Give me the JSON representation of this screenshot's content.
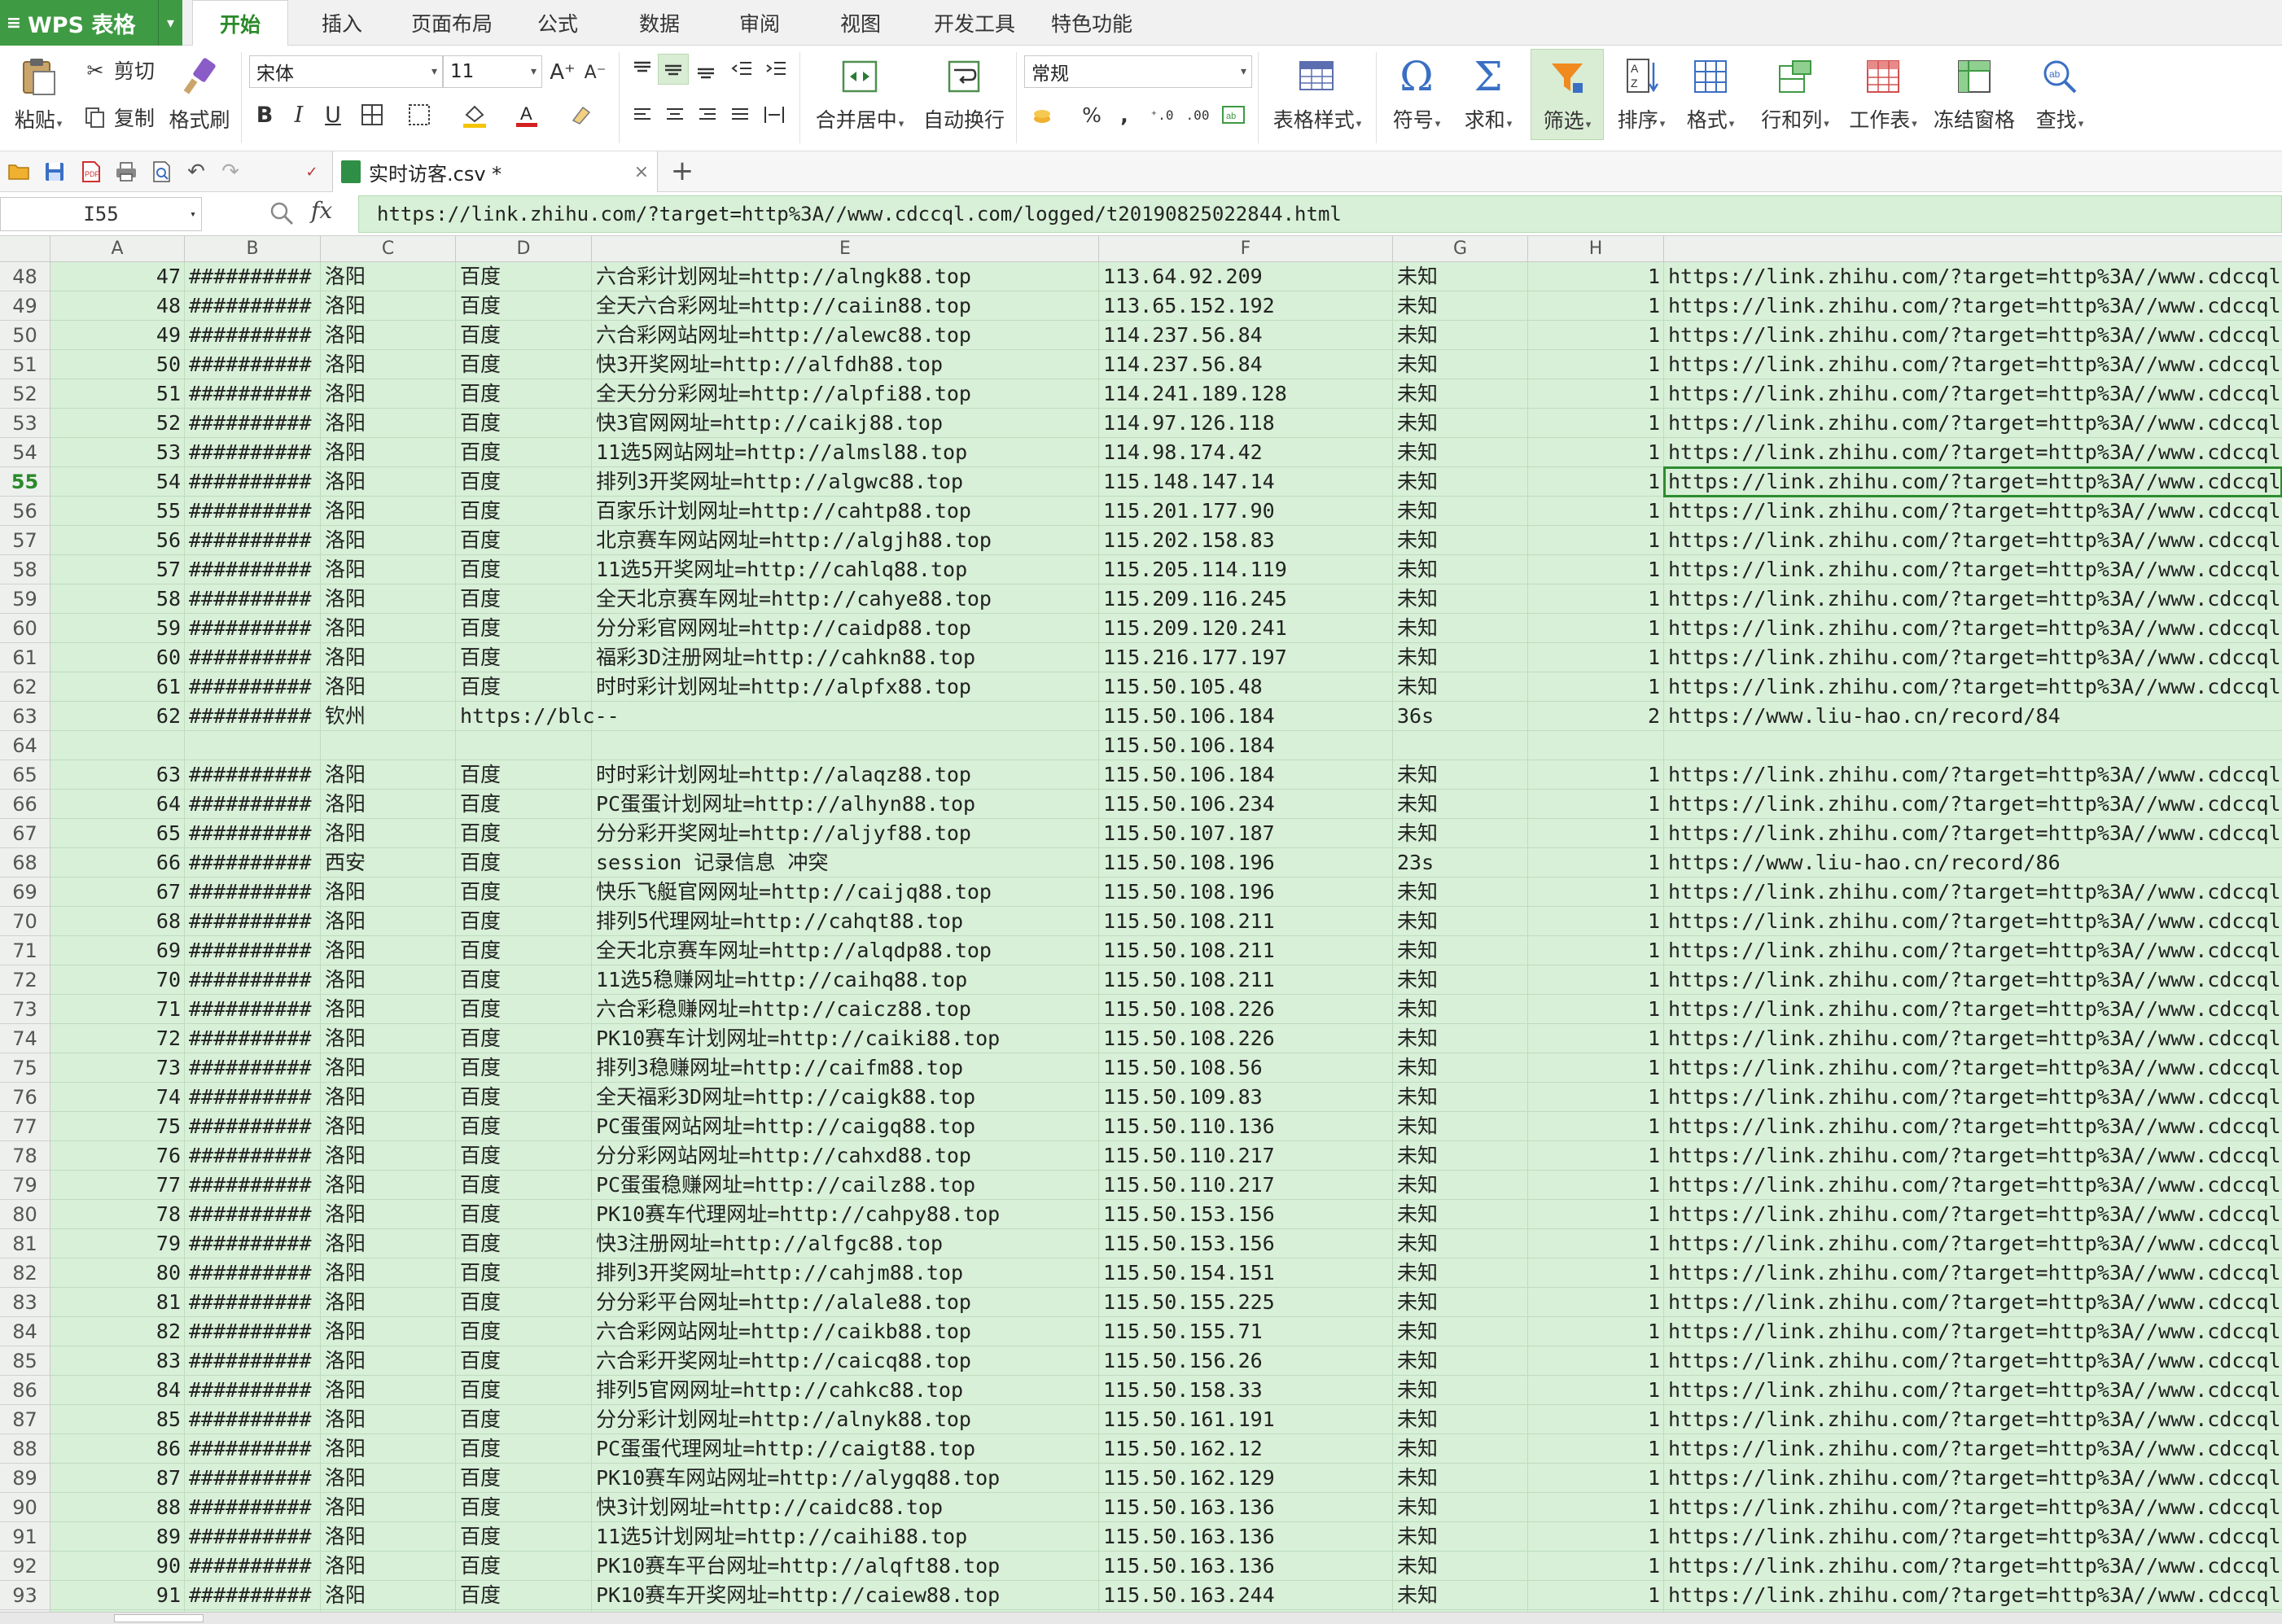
{
  "app": {
    "name": "WPS 表格"
  },
  "ribbon_tabs": [
    "开始",
    "插入",
    "页面布局",
    "公式",
    "数据",
    "审阅",
    "视图",
    "开发工具",
    "特色功能"
  ],
  "ribbon": {
    "paste": "粘贴",
    "cut": "剪切",
    "copy": "复制",
    "format_painter": "格式刷",
    "font_name": "宋体",
    "font_size": "11",
    "merge_center": "合并居中",
    "wrap_text": "自动换行",
    "number_format": "常规",
    "table_style": "表格样式",
    "symbol": "符号",
    "sum": "求和",
    "filter": "筛选",
    "sort": "排序",
    "format": "格式",
    "rows_cols": "行和列",
    "worksheet": "工作表",
    "freeze": "冻结窗格",
    "find": "查找",
    "percent": "%",
    "comma": ","
  },
  "document_tab": {
    "name": "实时访客.csv *"
  },
  "formula_bar": {
    "cell_ref": "I55",
    "fx": "fx",
    "value": "https://link.zhihu.com/?target=http%3A//www.cdccql.com/logged/t20190825022844.html"
  },
  "columns": [
    "A",
    "B",
    "C",
    "D",
    "E",
    "F",
    "G",
    "H"
  ],
  "rows": [
    {
      "n": "48",
      "a": "47",
      "b": "##########",
      "c": "洛阳",
      "d": "百度",
      "e": "六合彩计划网址=http://alngk88.top",
      "f": "113.64.92.209",
      "g": "未知",
      "h": "1",
      "i": "https://link.zhihu.com/?target=http%3A//www.cdccql"
    },
    {
      "n": "49",
      "a": "48",
      "b": "##########",
      "c": "洛阳",
      "d": "百度",
      "e": "全天六合彩网址=http://caiin88.top",
      "f": "113.65.152.192",
      "g": "未知",
      "h": "1",
      "i": "https://link.zhihu.com/?target=http%3A//www.cdccql"
    },
    {
      "n": "50",
      "a": "49",
      "b": "##########",
      "c": "洛阳",
      "d": "百度",
      "e": "六合彩网站网址=http://alewc88.top",
      "f": "114.237.56.84",
      "g": "未知",
      "h": "1",
      "i": "https://link.zhihu.com/?target=http%3A//www.cdccql"
    },
    {
      "n": "51",
      "a": "50",
      "b": "##########",
      "c": "洛阳",
      "d": "百度",
      "e": "快3开奖网址=http://alfdh88.top",
      "f": "114.237.56.84",
      "g": "未知",
      "h": "1",
      "i": "https://link.zhihu.com/?target=http%3A//www.cdccql"
    },
    {
      "n": "52",
      "a": "51",
      "b": "##########",
      "c": "洛阳",
      "d": "百度",
      "e": "全天分分彩网址=http://alpfi88.top",
      "f": "114.241.189.128",
      "g": "未知",
      "h": "1",
      "i": "https://link.zhihu.com/?target=http%3A//www.cdccql"
    },
    {
      "n": "53",
      "a": "52",
      "b": "##########",
      "c": "洛阳",
      "d": "百度",
      "e": "快3官网网址=http://caikj88.top",
      "f": "114.97.126.118",
      "g": "未知",
      "h": "1",
      "i": "https://link.zhihu.com/?target=http%3A//www.cdccql"
    },
    {
      "n": "54",
      "a": "53",
      "b": "##########",
      "c": "洛阳",
      "d": "百度",
      "e": "11选5网站网址=http://almsl88.top",
      "f": "114.98.174.42",
      "g": "未知",
      "h": "1",
      "i": "https://link.zhihu.com/?target=http%3A//www.cdccql"
    },
    {
      "n": "55",
      "a": "54",
      "b": "##########",
      "c": "洛阳",
      "d": "百度",
      "e": "排列3开奖网址=http://algwc88.top",
      "f": "115.148.147.14",
      "g": "未知",
      "h": "1",
      "i": "https://link.zhihu.com/?target=http%3A//www.cdccql"
    },
    {
      "n": "56",
      "a": "55",
      "b": "##########",
      "c": "洛阳",
      "d": "百度",
      "e": "百家乐计划网址=http://cahtp88.top",
      "f": "115.201.177.90",
      "g": "未知",
      "h": "1",
      "i": "https://link.zhihu.com/?target=http%3A//www.cdccql"
    },
    {
      "n": "57",
      "a": "56",
      "b": "##########",
      "c": "洛阳",
      "d": "百度",
      "e": "北京赛车网站网址=http://algjh88.top",
      "f": "115.202.158.83",
      "g": "未知",
      "h": "1",
      "i": "https://link.zhihu.com/?target=http%3A//www.cdccql"
    },
    {
      "n": "58",
      "a": "57",
      "b": "##########",
      "c": "洛阳",
      "d": "百度",
      "e": "11选5开奖网址=http://cahlq88.top",
      "f": "115.205.114.119",
      "g": "未知",
      "h": "1",
      "i": "https://link.zhihu.com/?target=http%3A//www.cdccql"
    },
    {
      "n": "59",
      "a": "58",
      "b": "##########",
      "c": "洛阳",
      "d": "百度",
      "e": "全天北京赛车网址=http://cahye88.top",
      "f": "115.209.116.245",
      "g": "未知",
      "h": "1",
      "i": "https://link.zhihu.com/?target=http%3A//www.cdccql"
    },
    {
      "n": "60",
      "a": "59",
      "b": "##########",
      "c": "洛阳",
      "d": "百度",
      "e": "分分彩官网网址=http://caidp88.top",
      "f": "115.209.120.241",
      "g": "未知",
      "h": "1",
      "i": "https://link.zhihu.com/?target=http%3A//www.cdccql"
    },
    {
      "n": "61",
      "a": "60",
      "b": "##########",
      "c": "洛阳",
      "d": "百度",
      "e": "福彩3D注册网址=http://cahkn88.top",
      "f": "115.216.177.197",
      "g": "未知",
      "h": "1",
      "i": "https://link.zhihu.com/?target=http%3A//www.cdccql"
    },
    {
      "n": "62",
      "a": "61",
      "b": "##########",
      "c": "洛阳",
      "d": "百度",
      "e": "时时彩计划网址=http://alpfx88.top",
      "f": "115.50.105.48",
      "g": "未知",
      "h": "1",
      "i": "https://link.zhihu.com/?target=http%3A//www.cdccql"
    },
    {
      "n": "63",
      "a": "62",
      "b": "##########",
      "c": "钦州",
      "d": "https://blc--",
      "e": "",
      "f": "115.50.106.184",
      "g": "36s",
      "h": "2",
      "i": "https://www.liu-hao.cn/record/84"
    },
    {
      "n": "64",
      "a": "",
      "b": "",
      "c": "",
      "d": "",
      "e": "",
      "f": "115.50.106.184",
      "g": "",
      "h": "",
      "i": ""
    },
    {
      "n": "65",
      "a": "63",
      "b": "##########",
      "c": "洛阳",
      "d": "百度",
      "e": "时时彩计划网址=http://alaqz88.top",
      "f": "115.50.106.184",
      "g": "未知",
      "h": "1",
      "i": "https://link.zhihu.com/?target=http%3A//www.cdccql"
    },
    {
      "n": "66",
      "a": "64",
      "b": "##########",
      "c": "洛阳",
      "d": "百度",
      "e": "PC蛋蛋计划网址=http://alhyn88.top",
      "f": "115.50.106.234",
      "g": "未知",
      "h": "1",
      "i": "https://link.zhihu.com/?target=http%3A//www.cdccql"
    },
    {
      "n": "67",
      "a": "65",
      "b": "##########",
      "c": "洛阳",
      "d": "百度",
      "e": "分分彩开奖网址=http://aljyf88.top",
      "f": "115.50.107.187",
      "g": "未知",
      "h": "1",
      "i": "https://link.zhihu.com/?target=http%3A//www.cdccql"
    },
    {
      "n": "68",
      "a": "66",
      "b": "##########",
      "c": "西安",
      "d": "百度",
      "e": "session 记录信息 冲突",
      "f": "115.50.108.196",
      "g": "23s",
      "h": "1",
      "i": "https://www.liu-hao.cn/record/86"
    },
    {
      "n": "69",
      "a": "67",
      "b": "##########",
      "c": "洛阳",
      "d": "百度",
      "e": "快乐飞艇官网网址=http://caijq88.top",
      "f": "115.50.108.196",
      "g": "未知",
      "h": "1",
      "i": "https://link.zhihu.com/?target=http%3A//www.cdccql"
    },
    {
      "n": "70",
      "a": "68",
      "b": "##########",
      "c": "洛阳",
      "d": "百度",
      "e": "排列5代理网址=http://cahqt88.top",
      "f": "115.50.108.211",
      "g": "未知",
      "h": "1",
      "i": "https://link.zhihu.com/?target=http%3A//www.cdccql"
    },
    {
      "n": "71",
      "a": "69",
      "b": "##########",
      "c": "洛阳",
      "d": "百度",
      "e": "全天北京赛车网址=http://alqdp88.top",
      "f": "115.50.108.211",
      "g": "未知",
      "h": "1",
      "i": "https://link.zhihu.com/?target=http%3A//www.cdccql"
    },
    {
      "n": "72",
      "a": "70",
      "b": "##########",
      "c": "洛阳",
      "d": "百度",
      "e": "11选5稳赚网址=http://caihq88.top",
      "f": "115.50.108.211",
      "g": "未知",
      "h": "1",
      "i": "https://link.zhihu.com/?target=http%3A//www.cdccql"
    },
    {
      "n": "73",
      "a": "71",
      "b": "##########",
      "c": "洛阳",
      "d": "百度",
      "e": "六合彩稳赚网址=http://caicz88.top",
      "f": "115.50.108.226",
      "g": "未知",
      "h": "1",
      "i": "https://link.zhihu.com/?target=http%3A//www.cdccql"
    },
    {
      "n": "74",
      "a": "72",
      "b": "##########",
      "c": "洛阳",
      "d": "百度",
      "e": "PK10赛车计划网址=http://caiki88.top",
      "f": "115.50.108.226",
      "g": "未知",
      "h": "1",
      "i": "https://link.zhihu.com/?target=http%3A//www.cdccql"
    },
    {
      "n": "75",
      "a": "73",
      "b": "##########",
      "c": "洛阳",
      "d": "百度",
      "e": "排列3稳赚网址=http://caifm88.top",
      "f": "115.50.108.56",
      "g": "未知",
      "h": "1",
      "i": "https://link.zhihu.com/?target=http%3A//www.cdccql"
    },
    {
      "n": "76",
      "a": "74",
      "b": "##########",
      "c": "洛阳",
      "d": "百度",
      "e": "全天福彩3D网址=http://caigk88.top",
      "f": "115.50.109.83",
      "g": "未知",
      "h": "1",
      "i": "https://link.zhihu.com/?target=http%3A//www.cdccql"
    },
    {
      "n": "77",
      "a": "75",
      "b": "##########",
      "c": "洛阳",
      "d": "百度",
      "e": "PC蛋蛋网站网址=http://caigq88.top",
      "f": "115.50.110.136",
      "g": "未知",
      "h": "1",
      "i": "https://link.zhihu.com/?target=http%3A//www.cdccql"
    },
    {
      "n": "78",
      "a": "76",
      "b": "##########",
      "c": "洛阳",
      "d": "百度",
      "e": "分分彩网站网址=http://cahxd88.top",
      "f": "115.50.110.217",
      "g": "未知",
      "h": "1",
      "i": "https://link.zhihu.com/?target=http%3A//www.cdccql"
    },
    {
      "n": "79",
      "a": "77",
      "b": "##########",
      "c": "洛阳",
      "d": "百度",
      "e": "PC蛋蛋稳赚网址=http://cailz88.top",
      "f": "115.50.110.217",
      "g": "未知",
      "h": "1",
      "i": "https://link.zhihu.com/?target=http%3A//www.cdccql"
    },
    {
      "n": "80",
      "a": "78",
      "b": "##########",
      "c": "洛阳",
      "d": "百度",
      "e": "PK10赛车代理网址=http://cahpy88.top",
      "f": "115.50.153.156",
      "g": "未知",
      "h": "1",
      "i": "https://link.zhihu.com/?target=http%3A//www.cdccql"
    },
    {
      "n": "81",
      "a": "79",
      "b": "##########",
      "c": "洛阳",
      "d": "百度",
      "e": "快3注册网址=http://alfgc88.top",
      "f": "115.50.153.156",
      "g": "未知",
      "h": "1",
      "i": "https://link.zhihu.com/?target=http%3A//www.cdccql"
    },
    {
      "n": "82",
      "a": "80",
      "b": "##########",
      "c": "洛阳",
      "d": "百度",
      "e": "排列3开奖网址=http://cahjm88.top",
      "f": "115.50.154.151",
      "g": "未知",
      "h": "1",
      "i": "https://link.zhihu.com/?target=http%3A//www.cdccql"
    },
    {
      "n": "83",
      "a": "81",
      "b": "##########",
      "c": "洛阳",
      "d": "百度",
      "e": "分分彩平台网址=http://alale88.top",
      "f": "115.50.155.225",
      "g": "未知",
      "h": "1",
      "i": "https://link.zhihu.com/?target=http%3A//www.cdccql"
    },
    {
      "n": "84",
      "a": "82",
      "b": "##########",
      "c": "洛阳",
      "d": "百度",
      "e": "六合彩网站网址=http://caikb88.top",
      "f": "115.50.155.71",
      "g": "未知",
      "h": "1",
      "i": "https://link.zhihu.com/?target=http%3A//www.cdccql"
    },
    {
      "n": "85",
      "a": "83",
      "b": "##########",
      "c": "洛阳",
      "d": "百度",
      "e": "六合彩开奖网址=http://caicq88.top",
      "f": "115.50.156.26",
      "g": "未知",
      "h": "1",
      "i": "https://link.zhihu.com/?target=http%3A//www.cdccql"
    },
    {
      "n": "86",
      "a": "84",
      "b": "##########",
      "c": "洛阳",
      "d": "百度",
      "e": "排列5官网网址=http://cahkc88.top",
      "f": "115.50.158.33",
      "g": "未知",
      "h": "1",
      "i": "https://link.zhihu.com/?target=http%3A//www.cdccql"
    },
    {
      "n": "87",
      "a": "85",
      "b": "##########",
      "c": "洛阳",
      "d": "百度",
      "e": "分分彩计划网址=http://alnyk88.top",
      "f": "115.50.161.191",
      "g": "未知",
      "h": "1",
      "i": "https://link.zhihu.com/?target=http%3A//www.cdccql"
    },
    {
      "n": "88",
      "a": "86",
      "b": "##########",
      "c": "洛阳",
      "d": "百度",
      "e": "PC蛋蛋代理网址=http://caigt88.top",
      "f": "115.50.162.12",
      "g": "未知",
      "h": "1",
      "i": "https://link.zhihu.com/?target=http%3A//www.cdccql"
    },
    {
      "n": "89",
      "a": "87",
      "b": "##########",
      "c": "洛阳",
      "d": "百度",
      "e": "PK10赛车网站网址=http://alygq88.top",
      "f": "115.50.162.129",
      "g": "未知",
      "h": "1",
      "i": "https://link.zhihu.com/?target=http%3A//www.cdccql"
    },
    {
      "n": "90",
      "a": "88",
      "b": "##########",
      "c": "洛阳",
      "d": "百度",
      "e": "快3计划网址=http://caidc88.top",
      "f": "115.50.163.136",
      "g": "未知",
      "h": "1",
      "i": "https://link.zhihu.com/?target=http%3A//www.cdccql"
    },
    {
      "n": "91",
      "a": "89",
      "b": "##########",
      "c": "洛阳",
      "d": "百度",
      "e": "11选5计划网址=http://caihi88.top",
      "f": "115.50.163.136",
      "g": "未知",
      "h": "1",
      "i": "https://link.zhihu.com/?target=http%3A//www.cdccql"
    },
    {
      "n": "92",
      "a": "90",
      "b": "##########",
      "c": "洛阳",
      "d": "百度",
      "e": "PK10赛车平台网址=http://alqft88.top",
      "f": "115.50.163.136",
      "g": "未知",
      "h": "1",
      "i": "https://link.zhihu.com/?target=http%3A//www.cdccql"
    },
    {
      "n": "93",
      "a": "91",
      "b": "##########",
      "c": "洛阳",
      "d": "百度",
      "e": "PK10赛车开奖网址=http://caiew88.top",
      "f": "115.50.163.244",
      "g": "未知",
      "h": "1",
      "i": "https://link.zhihu.com/?target=http%3A//www.cdccql"
    }
  ],
  "selection": {
    "row_number": "55"
  },
  "colors": {
    "accent": "#3f9a44",
    "cell_bg": "#d7f0d7",
    "selection_border": "#2e8b2e"
  }
}
